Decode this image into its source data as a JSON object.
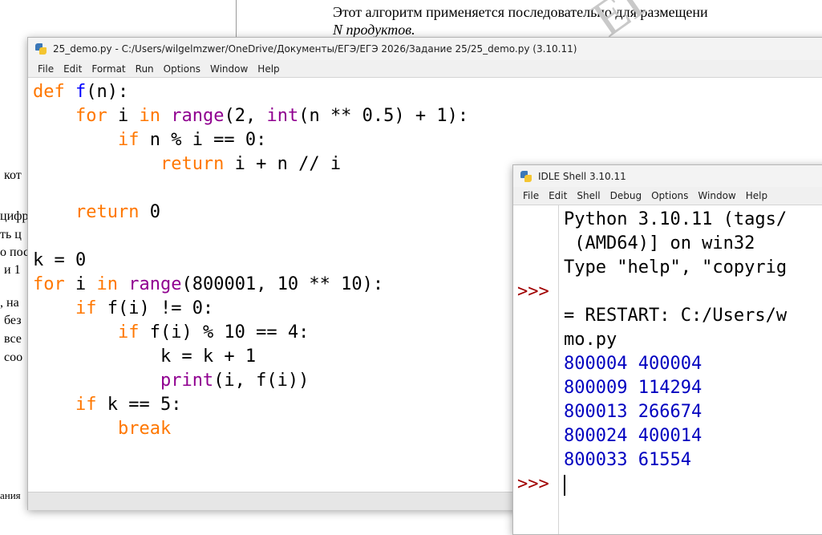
{
  "document": {
    "line1": "Этот алгоритм применяется последовательно для размещени",
    "line2": "N продуктов.",
    "watermark": "ЕГ",
    "left_fragments": [
      "кот",
      "цифр",
      "ть ц",
      "о пос",
      "и 1",
      ", на",
      "без",
      "все",
      "соо",
      "ания"
    ]
  },
  "editor": {
    "title": "25_demo.py - C:/Users/wilgelmzwer/OneDrive/Документы/ЕГЭ/ЕГЭ 2026/Задание 25/25_demo.py (3.10.11)",
    "icon": "python-file-icon",
    "menu": [
      "File",
      "Edit",
      "Format",
      "Run",
      "Options",
      "Window",
      "Help"
    ],
    "code": [
      [
        {
          "t": "def",
          "c": "kw"
        },
        {
          "t": " "
        },
        {
          "t": "f",
          "c": "df"
        },
        {
          "t": "(n):"
        }
      ],
      [
        {
          "t": "    "
        },
        {
          "t": "for",
          "c": "kw"
        },
        {
          "t": " i "
        },
        {
          "t": "in",
          "c": "kw"
        },
        {
          "t": " "
        },
        {
          "t": "range",
          "c": "bi"
        },
        {
          "t": "(2, "
        },
        {
          "t": "int",
          "c": "bi"
        },
        {
          "t": "(n ** 0.5) + 1):"
        }
      ],
      [
        {
          "t": "        "
        },
        {
          "t": "if",
          "c": "kw"
        },
        {
          "t": " n % i == 0:"
        }
      ],
      [
        {
          "t": "            "
        },
        {
          "t": "return",
          "c": "kw"
        },
        {
          "t": " i + n // i"
        }
      ],
      [
        {
          "t": ""
        }
      ],
      [
        {
          "t": "    "
        },
        {
          "t": "return",
          "c": "kw"
        },
        {
          "t": " 0"
        }
      ],
      [
        {
          "t": ""
        }
      ],
      [
        {
          "t": "k = 0"
        }
      ],
      [
        {
          "t": "for",
          "c": "kw"
        },
        {
          "t": " i "
        },
        {
          "t": "in",
          "c": "kw"
        },
        {
          "t": " "
        },
        {
          "t": "range",
          "c": "bi"
        },
        {
          "t": "(800001, 10 ** 10):"
        }
      ],
      [
        {
          "t": "    "
        },
        {
          "t": "if",
          "c": "kw"
        },
        {
          "t": " f(i) != 0:"
        }
      ],
      [
        {
          "t": "        "
        },
        {
          "t": "if",
          "c": "kw"
        },
        {
          "t": " f(i) % 10 == 4:"
        }
      ],
      [
        {
          "t": "            k = k + 1"
        }
      ],
      [
        {
          "t": "            "
        },
        {
          "t": "print",
          "c": "bi"
        },
        {
          "t": "(i, f(i))"
        }
      ],
      [
        {
          "t": "    "
        },
        {
          "t": "if",
          "c": "kw"
        },
        {
          "t": " k == 5:"
        }
      ],
      [
        {
          "t": "        "
        },
        {
          "t": "break",
          "c": "kw"
        }
      ]
    ]
  },
  "shell": {
    "title": "IDLE Shell 3.10.11",
    "icon": "python-shell-icon",
    "menu": [
      "File",
      "Edit",
      "Shell",
      "Debug",
      "Options",
      "Window",
      "Help"
    ],
    "prompt": ">>>",
    "lines": [
      {
        "t": "Python 3.10.11 (tags/",
        "c": ""
      },
      {
        "t": " (AMD64)] on win32",
        "c": ""
      },
      {
        "t": "Type \"help\", \"copyrig",
        "c": ""
      },
      {
        "t": "",
        "c": ""
      },
      {
        "t": "= RESTART: C:/Users/w",
        "c": ""
      },
      {
        "t": "mo.py",
        "c": ""
      },
      {
        "t": "800004 400004",
        "c": "out"
      },
      {
        "t": "800009 114294",
        "c": "out"
      },
      {
        "t": "800013 266674",
        "c": "out"
      },
      {
        "t": "800024 400014",
        "c": "out"
      },
      {
        "t": "800033 61554",
        "c": "out"
      }
    ]
  }
}
